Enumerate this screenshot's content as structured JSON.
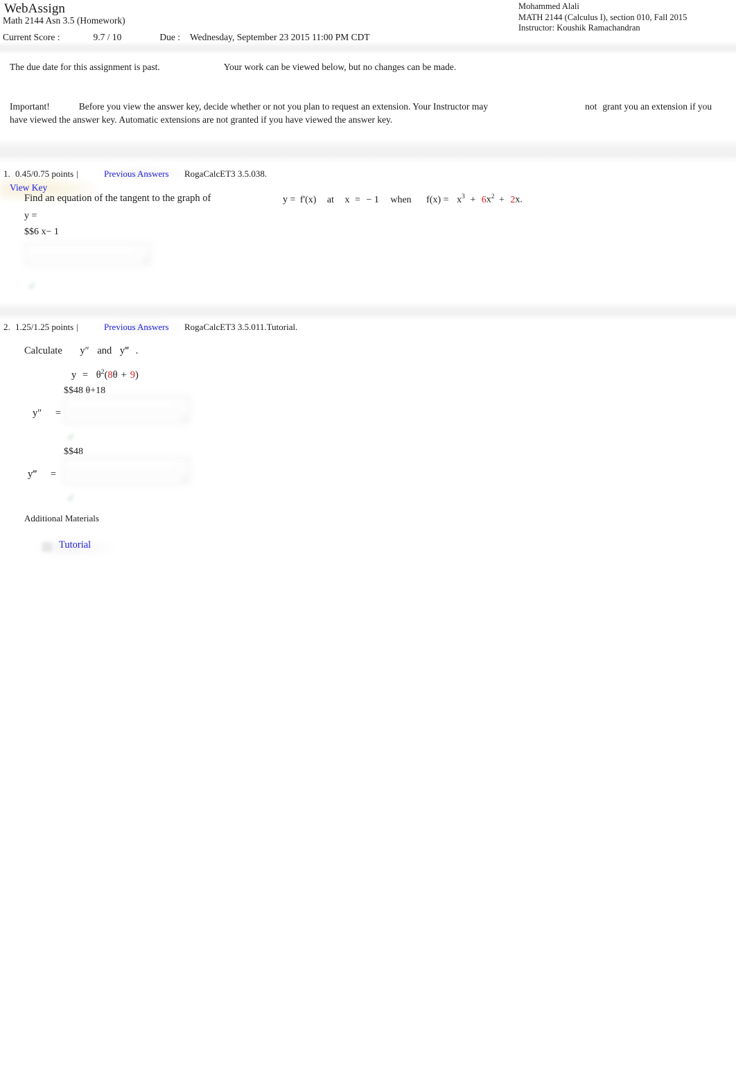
{
  "header": {
    "brand": "WebAssign",
    "assignment_title": "Math 2144 Asn 3.5 (Homework)",
    "student_name": "Mohammed Alali",
    "course_line": "MATH 2144 (Calculus I), section 010, Fall 2015",
    "instructor_line": "Instructor: Koushik Ramachandran",
    "score_label": "Current Score :",
    "score_value": "9.7 / 10",
    "due_label": "Due :",
    "due_value": "Wednesday, September 23 2015 11:00 PM CDT"
  },
  "notice": {
    "past_due": "The due date for this assignment is past.",
    "view_only": "Your work can be viewed below, but no changes can be made.",
    "important_word": "Important!",
    "important_body": "Before you view the answer key, decide whether or not you plan to request an extension. Your Instructor may",
    "important_not": "not",
    "important_tail": "grant you an extension if you",
    "important_line2": "have viewed the answer key. Automatic extensions are not granted if you have viewed the answer key.",
    "view_key_label": "View Key"
  },
  "questions": [
    {
      "number": "1.",
      "points": "0.45/0.75 points",
      "separator": "|",
      "previous_answers": "Previous Answers",
      "code": "RogaCalcET3 3.5.038.",
      "prompt_text": "Find an equation of the tangent to the graph of",
      "math_y": "y",
      "math_eq1": "=",
      "math_fprime": "f'(x)",
      "math_at": "at",
      "math_x": "x",
      "math_eq2": "=",
      "math_xval": "− 1",
      "math_when": "when",
      "math_fx": "f(x) =",
      "term1_base": "x",
      "term1_exp": "3",
      "plus1": "+",
      "term2_coeff": "6",
      "term2_base": "x",
      "term2_exp": "2",
      "plus2": "+",
      "term3_coeff": "2",
      "term3_base": "x.",
      "answer_label": "y  =",
      "answer_value": "$$6  x− 1",
      "check_glyph": "✓"
    },
    {
      "number": "2.",
      "points": "1.25/1.25 points",
      "separator": "|",
      "previous_answers": "Previous Answers",
      "code": "RogaCalcET3 3.5.011.Tutorial.",
      "prompt_calculate": "Calculate",
      "prompt_y2": "y″",
      "prompt_and": "and",
      "prompt_y3": "y‴",
      "prompt_period": ".",
      "eq_y": "y",
      "eq_equals": "=",
      "eq_theta": "θ",
      "eq_theta_exp": "2",
      "eq_open": "(",
      "eq_coeff8": "8",
      "eq_theta2": "θ",
      "eq_plus": "+",
      "eq_coeff9": "9",
      "eq_close": ")",
      "answer1_value": "$$48  θ+18",
      "answer1_label": "y″",
      "answer1_equals": "=",
      "answer2_value": "$$48",
      "answer2_label": "y‴",
      "answer2_equals": "=",
      "check_glyph": "✓",
      "additional_materials": "Additional Materials",
      "tutorial_label": "Tutorial"
    }
  ]
}
